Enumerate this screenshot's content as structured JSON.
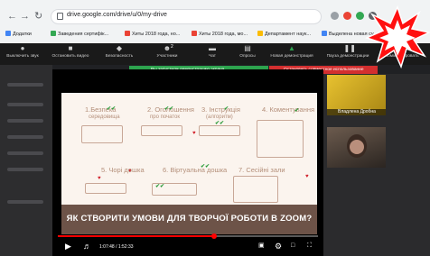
{
  "browser": {
    "url": "drive.google.com/drive/u/0/my-drive",
    "back_icon": "arrow-left-icon",
    "forward_icon": "arrow-right-icon",
    "reload_icon": "reload-icon",
    "bookmarks": [
      {
        "label": "Додатки",
        "color": "#4285f4"
      },
      {
        "label": "Заведения сертифік...",
        "color": "#34a853"
      },
      {
        "label": "Хиты 2018 года, но...",
        "color": "#ea4335"
      },
      {
        "label": "Хиты 2018 года, мо...",
        "color": "#ea4335"
      },
      {
        "label": "Департамент наук...",
        "color": "#fbbc04"
      },
      {
        "label": "Выделена новая су...",
        "color": "#4285f4"
      }
    ]
  },
  "zoom_toolbar": {
    "items": [
      {
        "label": "Выключить звук",
        "icon": "microphone-icon"
      },
      {
        "label": "Остановить видео",
        "icon": "video-camera-icon"
      },
      {
        "label": "Безопасность",
        "icon": "shield-icon"
      },
      {
        "label": "Участники",
        "icon": "participants-icon"
      },
      {
        "label": "Чат",
        "icon": "chat-icon"
      },
      {
        "label": "Опросы",
        "icon": "polls-icon"
      },
      {
        "label": "Новая демонстрация",
        "icon": "share-screen-icon"
      },
      {
        "label": "Пауза демонстрации",
        "icon": "pause-icon"
      },
      {
        "label": "Комментировать",
        "icon": "annotate-icon"
      }
    ],
    "participants_count": "2",
    "sharing_notice": "Вы запустили демонстрацию экрана",
    "stop_notice": "Остановить совместное использование",
    "accent_green": "#2da44e",
    "accent_red": "#d32f2f"
  },
  "slide": {
    "banner": "ЯК СТВОРИТИ УМОВИ ДЛЯ ТВОРЧОЇ РОБОТИ В ZOOM?",
    "steps_top": [
      {
        "label": "1.Безпека",
        "sub": "середовища"
      },
      {
        "label": "2. Оголошення",
        "sub": "про початок"
      },
      {
        "label": "3. Інструкція",
        "sub": "(алгоритм)"
      },
      {
        "label": "4. Коментування",
        "sub": ""
      }
    ],
    "steps_bottom": [
      {
        "label": "5. Чорі дошка"
      },
      {
        "label": "6. Віртуальна дошка"
      },
      {
        "label": "7. Сесійні зали"
      }
    ]
  },
  "player": {
    "time": "1:07:48 / 1:52:33",
    "progress": 0.6
  },
  "participants": [
    {
      "name": "Владлена Дробна"
    },
    {
      "name": ""
    }
  ]
}
